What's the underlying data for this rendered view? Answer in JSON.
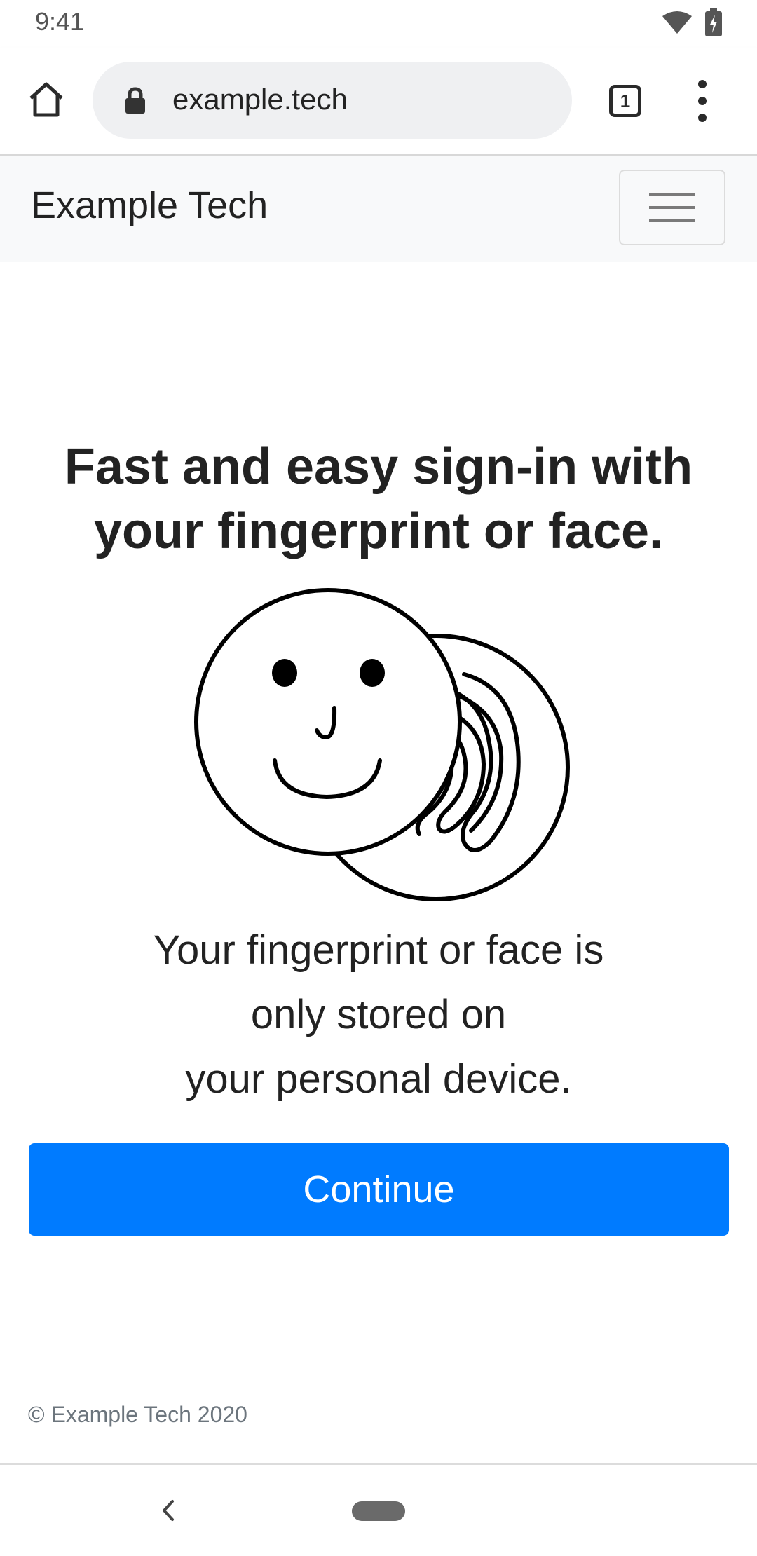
{
  "status_bar": {
    "time": "9:41",
    "icons": [
      "wifi-icon",
      "battery-charging-icon"
    ]
  },
  "browser": {
    "url": "example.tech",
    "tab_count": "1",
    "icons": [
      "home-icon",
      "lock-icon",
      "tab-switcher-icon",
      "more-vert-icon"
    ]
  },
  "navbar": {
    "brand": "Example Tech",
    "toggler_icon": "hamburger-menu-icon"
  },
  "main": {
    "headline_line1": "Fast and easy sign-in with",
    "headline_line2": "your fingerprint or face.",
    "illustration_icon": "face-fingerprint-illustration",
    "body_line1": "Your fingerprint or face is",
    "body_line2": "only stored on",
    "body_line3": "your personal device.",
    "continue_label": "Continue"
  },
  "footer": {
    "copyright": "© Example Tech 2020"
  },
  "system_nav": {
    "icons": [
      "back-icon",
      "home-pill-icon"
    ]
  },
  "colors": {
    "primary": "#007bff",
    "navbar_bg": "#f8f9fa",
    "text": "#222222",
    "muted": "#6c757d"
  }
}
